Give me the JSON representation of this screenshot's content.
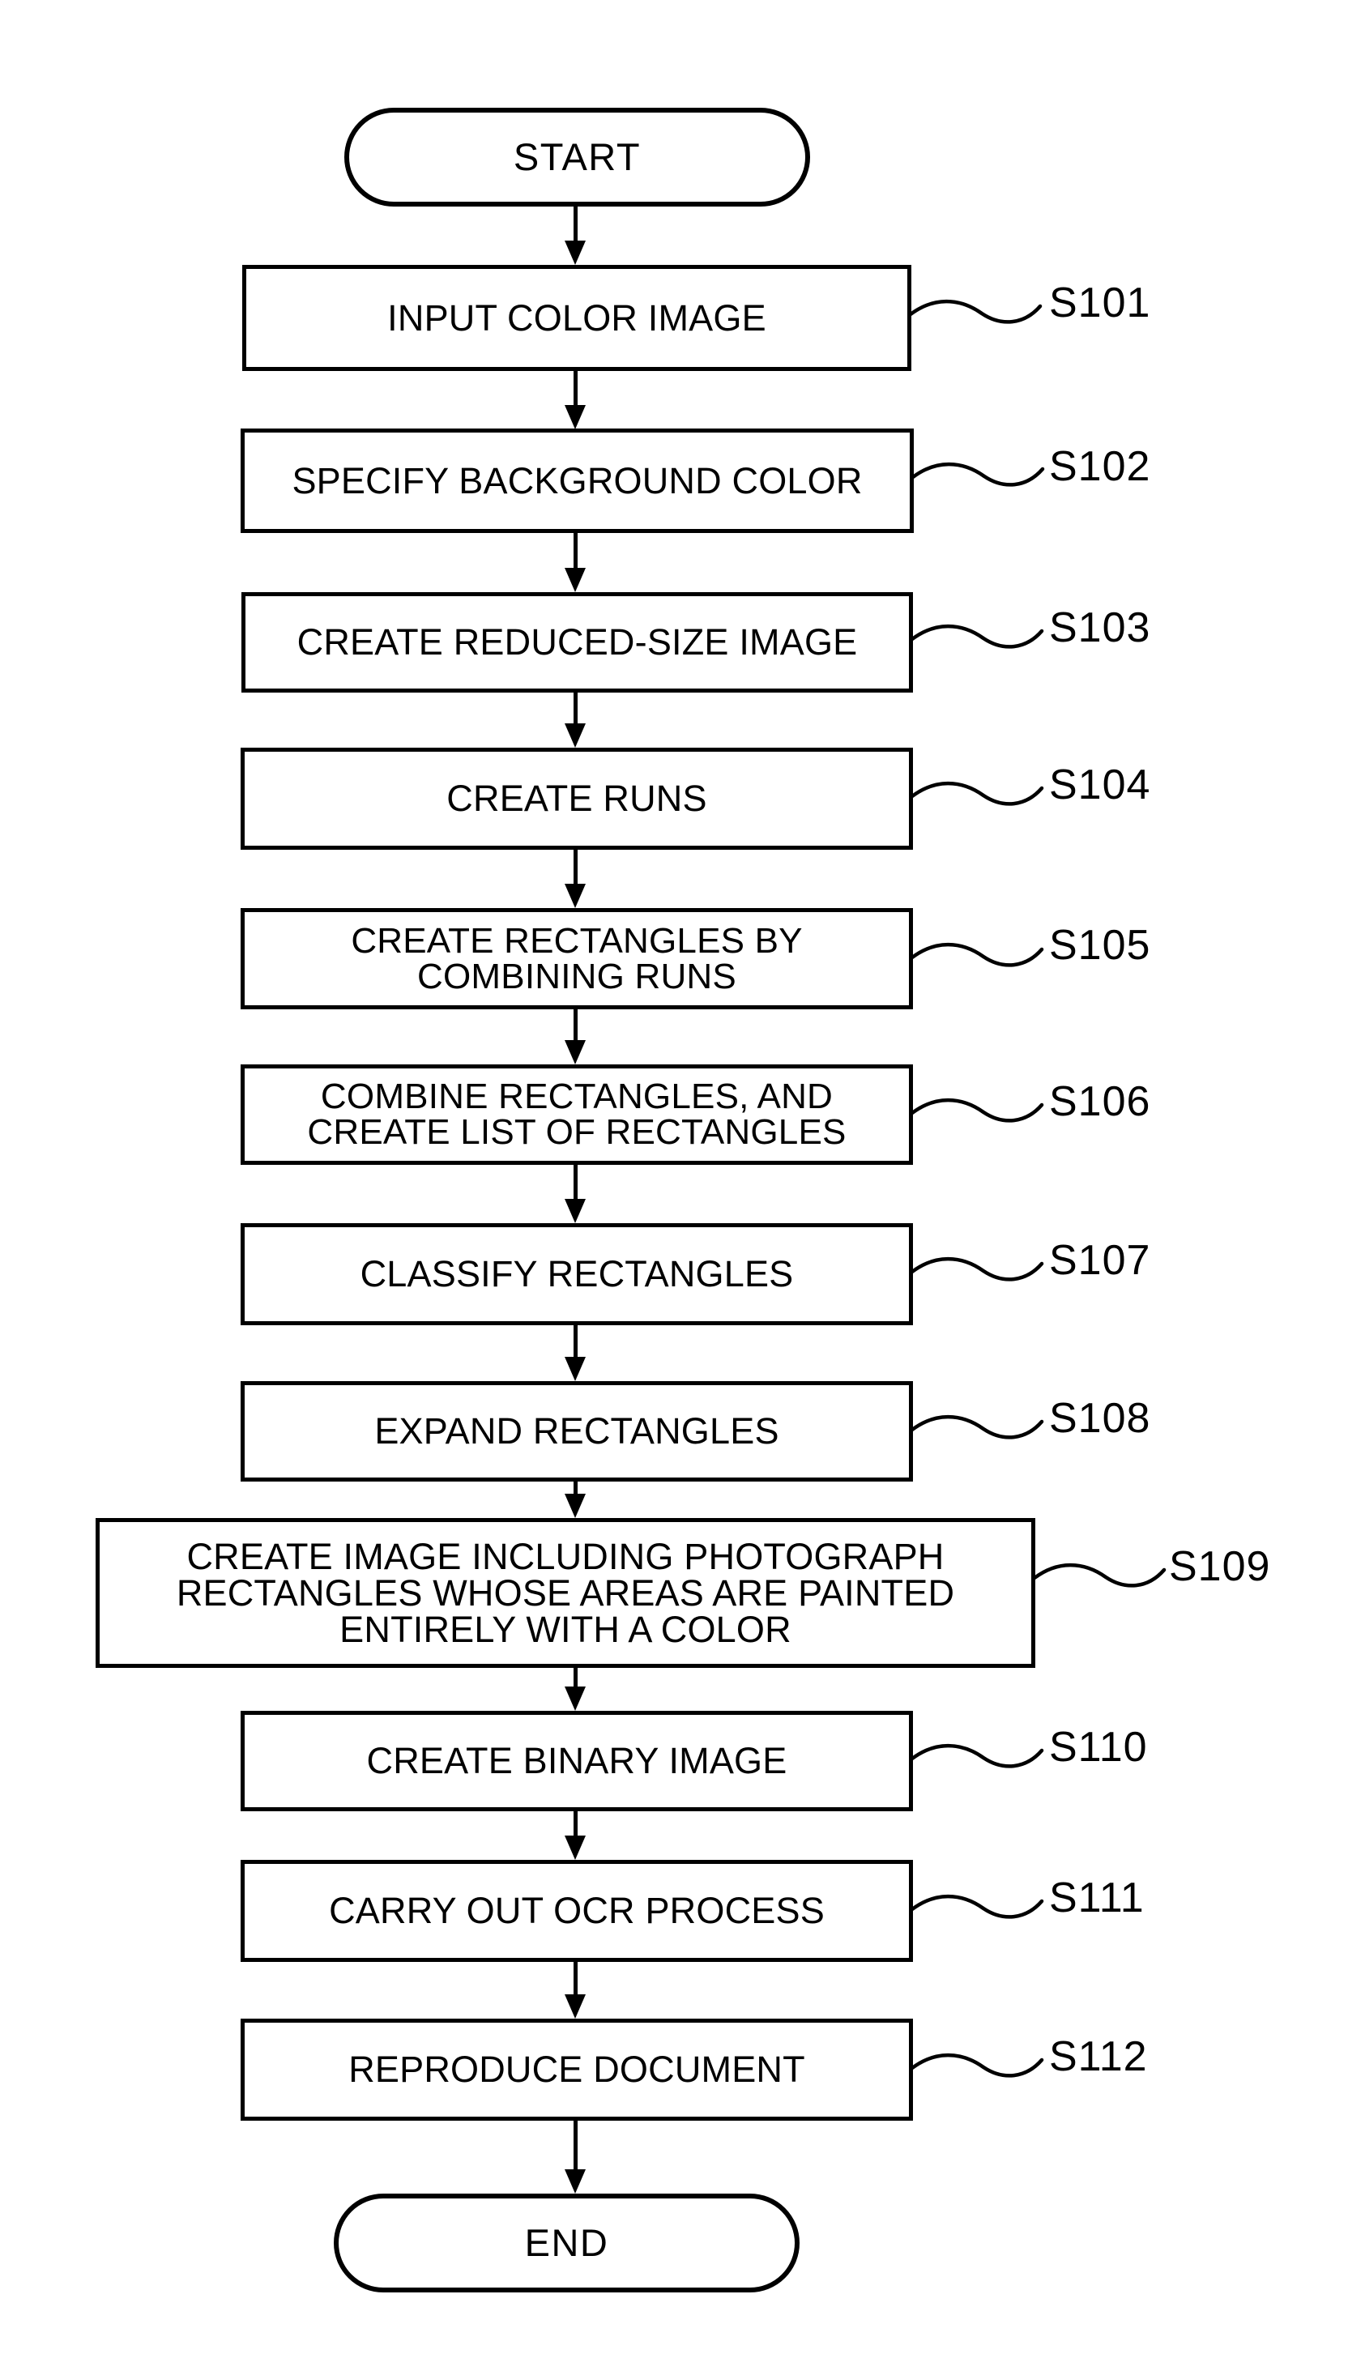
{
  "diagram": {
    "type": "flowchart",
    "orientation": "vertical",
    "line_color": "#000000",
    "background_color": "#ffffff",
    "nodes": [
      {
        "id": "start",
        "shape": "terminal",
        "text": "START"
      },
      {
        "id": "s101",
        "shape": "process",
        "text": "INPUT COLOR IMAGE"
      },
      {
        "id": "s102",
        "shape": "process",
        "text": "SPECIFY BACKGROUND COLOR"
      },
      {
        "id": "s103",
        "shape": "process",
        "text": "CREATE REDUCED-SIZE IMAGE"
      },
      {
        "id": "s104",
        "shape": "process",
        "text": "CREATE RUNS"
      },
      {
        "id": "s105",
        "shape": "process",
        "text": "CREATE RECTANGLES BY\nCOMBINING RUNS"
      },
      {
        "id": "s106",
        "shape": "process",
        "text": "COMBINE RECTANGLES, AND\nCREATE LIST OF RECTANGLES"
      },
      {
        "id": "s107",
        "shape": "process",
        "text": "CLASSIFY RECTANGLES"
      },
      {
        "id": "s108",
        "shape": "process",
        "text": "EXPAND RECTANGLES"
      },
      {
        "id": "s109",
        "shape": "process",
        "text": "CREATE IMAGE INCLUDING PHOTOGRAPH\nRECTANGLES WHOSE AREAS ARE PAINTED\nENTIRELY WITH A COLOR"
      },
      {
        "id": "s110",
        "shape": "process",
        "text": "CREATE BINARY IMAGE"
      },
      {
        "id": "s111",
        "shape": "process",
        "text": "CARRY OUT OCR PROCESS"
      },
      {
        "id": "s112",
        "shape": "process",
        "text": "REPRODUCE DOCUMENT"
      },
      {
        "id": "end",
        "shape": "terminal",
        "text": "END"
      }
    ],
    "step_labels": [
      {
        "id": "lbl-s101",
        "text": "S101"
      },
      {
        "id": "lbl-s102",
        "text": "S102"
      },
      {
        "id": "lbl-s103",
        "text": "S103"
      },
      {
        "id": "lbl-s104",
        "text": "S104"
      },
      {
        "id": "lbl-s105",
        "text": "S105"
      },
      {
        "id": "lbl-s106",
        "text": "S106"
      },
      {
        "id": "lbl-s107",
        "text": "S107"
      },
      {
        "id": "lbl-s108",
        "text": "S108"
      },
      {
        "id": "lbl-s109",
        "text": "S109"
      },
      {
        "id": "lbl-s110",
        "text": "S110"
      },
      {
        "id": "lbl-s111",
        "text": "S111"
      },
      {
        "id": "lbl-s112",
        "text": "S112"
      }
    ]
  }
}
